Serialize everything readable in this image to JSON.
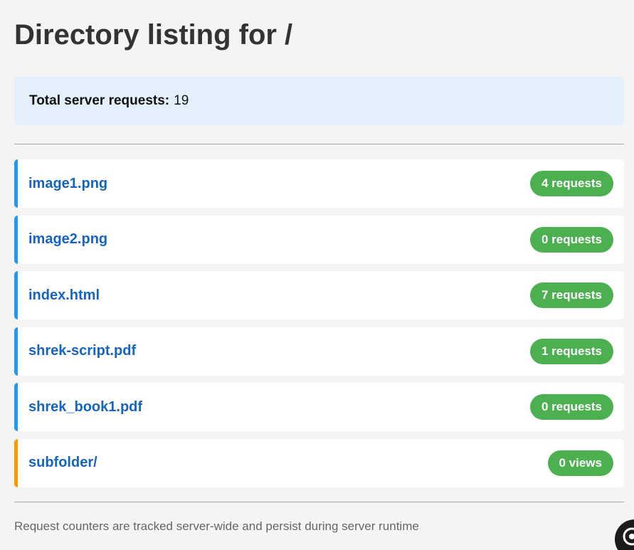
{
  "page": {
    "title": "Directory listing for /",
    "summary_label": "Total server requests:",
    "summary_value": "19",
    "footer_note": "Request counters are tracked server-wide and persist during server runtime"
  },
  "entries": [
    {
      "name": "image1.png",
      "kind": "file",
      "count": "4 requests"
    },
    {
      "name": "image2.png",
      "kind": "file",
      "count": "0 requests"
    },
    {
      "name": "index.html",
      "kind": "file",
      "count": "7 requests"
    },
    {
      "name": "shrek-script.pdf",
      "kind": "file",
      "count": "1 requests"
    },
    {
      "name": "shrek_book1.pdf",
      "kind": "file",
      "count": "0 requests"
    },
    {
      "name": "subfolder/",
      "kind": "folder",
      "count": "0 views"
    }
  ],
  "colors": {
    "file_accent": "#2196f3",
    "folder_accent": "#ff9800",
    "badge": "#4caf50",
    "link": "#1565c0",
    "summary_bg": "#e3f0fb"
  },
  "icons": {
    "corner_widget": "assistant-bubble-icon"
  }
}
